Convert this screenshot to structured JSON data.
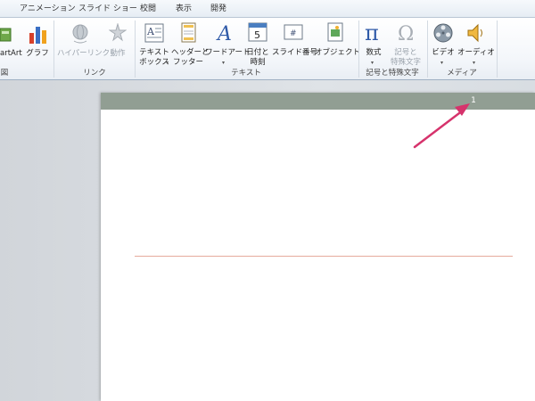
{
  "tabs": [
    "アニメーション",
    "スライド ショー",
    "校閲",
    "表示",
    "開発"
  ],
  "ribbon": {
    "smartart_label": "artArt",
    "graph_label": "グラフ",
    "cut_group_char": "図",
    "hyperlink_label": "ハイパーリンク",
    "action_label": "動作",
    "link_group": "リンク",
    "textbox_label": [
      "テキスト",
      "ボックス"
    ],
    "header_footer_label": [
      "ヘッダーと",
      "フッター"
    ],
    "wordart_label": "ワードアート",
    "datetime_label": [
      "日付と",
      "時刻"
    ],
    "slide_number_label": "スライド番号",
    "object_label": "オブジェクト",
    "text_group": "テキスト",
    "equation_label": "数式",
    "symbol_label": [
      "記号と",
      "特殊文字"
    ],
    "symbol_group": "記号と特殊文字",
    "video_label": "ビデオ",
    "audio_label": "オーディオ",
    "media_group": "メディア"
  },
  "slide": {
    "number": "1"
  },
  "colors": {
    "header_band": "#919e93",
    "callout_arrow": "#d6336c",
    "title_line": "#e6aa9c"
  }
}
